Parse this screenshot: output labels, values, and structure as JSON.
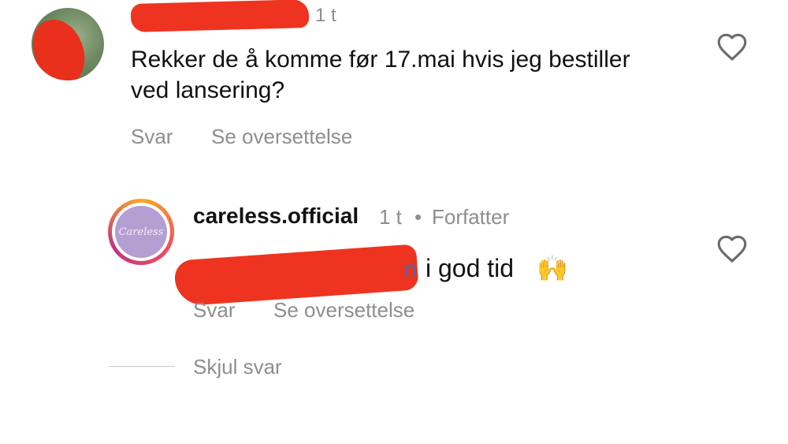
{
  "comment": {
    "time": "1 t",
    "text": "Rekker de å komme før 17.mai hvis jeg bestiller ved lansering?",
    "reply_label": "Svar",
    "translate_label": "Se oversettelse",
    "like_icon": "heart-outline-icon"
  },
  "reply": {
    "username": "careless.official",
    "time": "1 t",
    "separator": "•",
    "author_badge": "Forfatter",
    "avatar_text": "Careless",
    "mention_visible_tail": "n",
    "text": "i god tid",
    "emoji": "🙌",
    "reply_label": "Svar",
    "translate_label": "Se oversettelse",
    "like_icon": "heart-outline-icon"
  },
  "thread": {
    "hide_replies_label": "Skjul svar"
  },
  "colors": {
    "redaction": "#ee3420",
    "muted_text": "#8e8e8e",
    "mention": "#3d6fb5",
    "avatar_purple": "#b39fd1"
  }
}
